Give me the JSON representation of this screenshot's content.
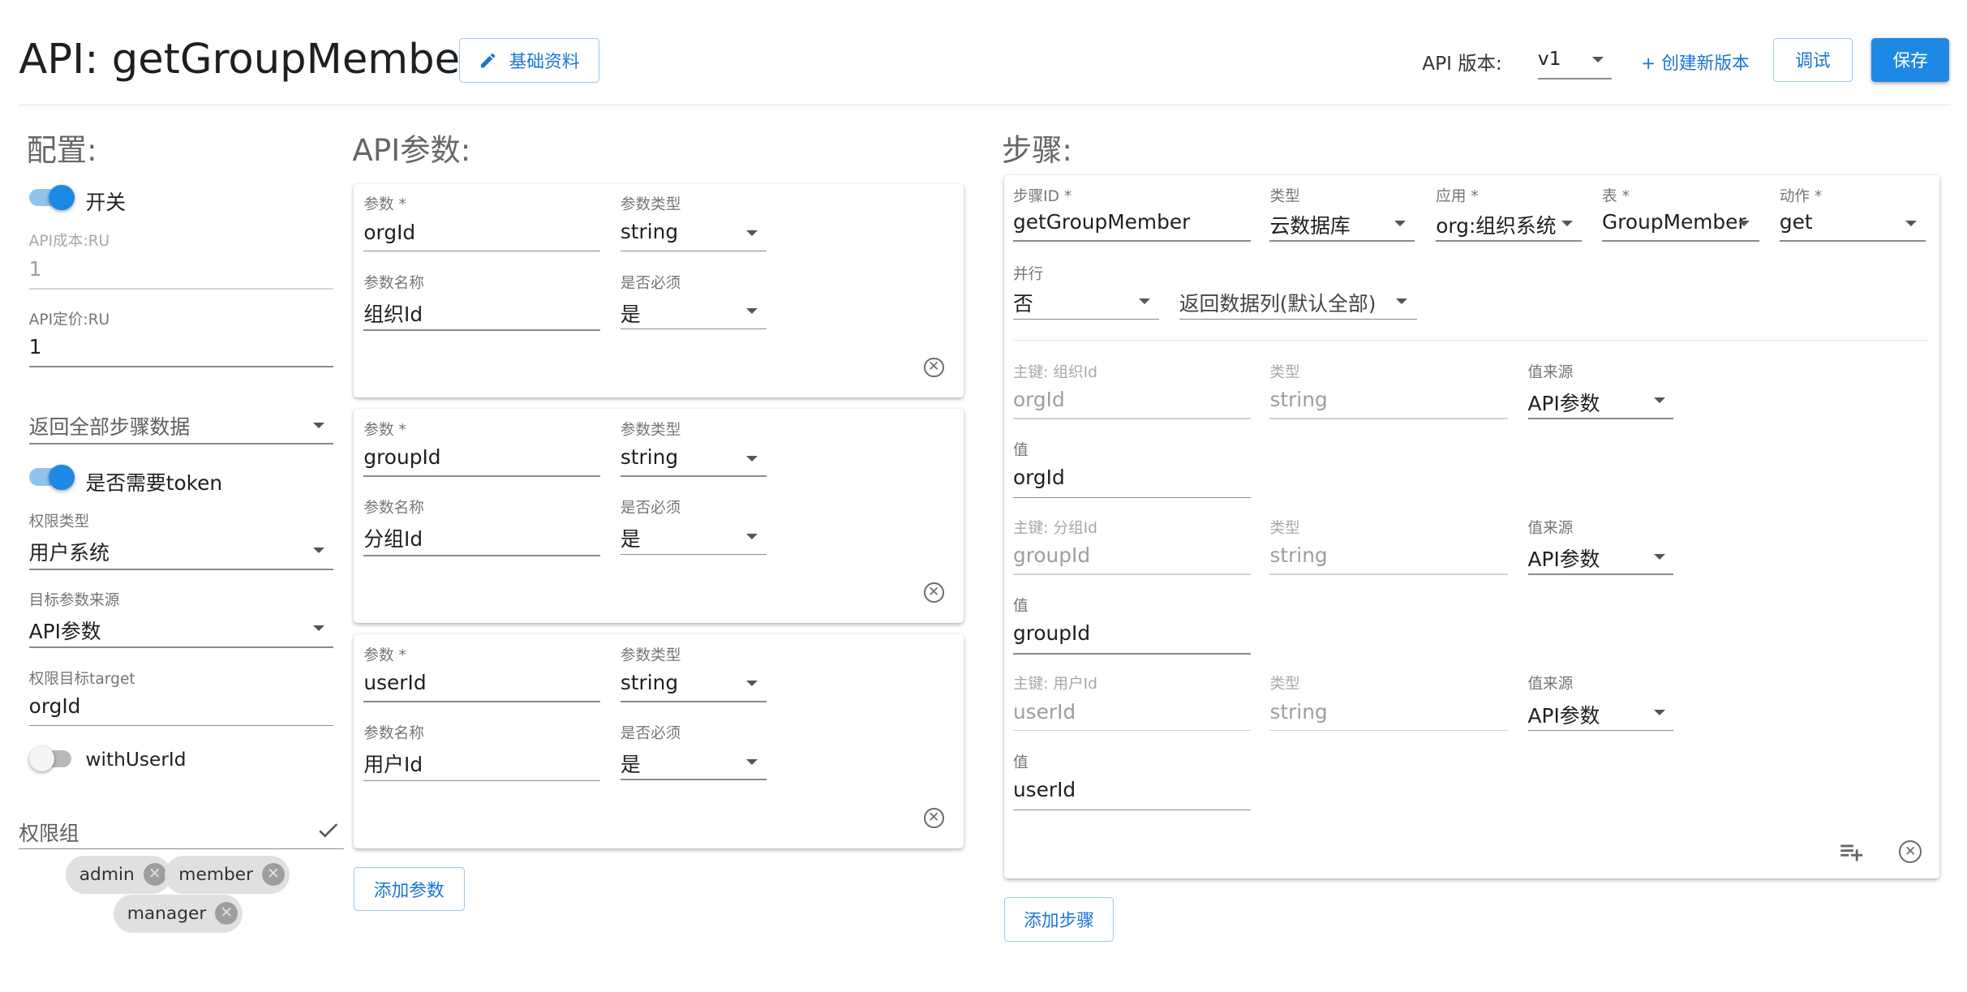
{
  "header": {
    "title": "API: getGroupMember",
    "basic_info_btn": "基础资料",
    "version_label": "API 版本:",
    "version_value": "v1",
    "create_version": "+ 创建新版本",
    "debug": "调试",
    "save": "保存"
  },
  "config": {
    "heading": "配置:",
    "switch_open_label": "开关",
    "api_cost_label": "API成本:RU",
    "api_cost_value": "1",
    "api_price_label": "API定价:RU",
    "api_price_value": "1",
    "return_steps_select": "返回全部步骤数据",
    "token_label": "是否需要token",
    "perm_type_label": "权限类型",
    "perm_type_value": "用户系统",
    "target_source_label": "目标参数来源",
    "target_source_value": "API参数",
    "perm_target_label": "权限目标target",
    "perm_target_value": "orgId",
    "with_user_id_label": "withUserId",
    "perm_group_label": "权限组",
    "perm_group_chips": [
      "admin",
      "member",
      "manager"
    ]
  },
  "params": {
    "heading": "API参数:",
    "labels": {
      "param": "参数",
      "type": "参数类型",
      "name": "参数名称",
      "required": "是否必须"
    },
    "items": [
      {
        "param": "orgId",
        "type": "string",
        "name": "组织Id",
        "required": "是"
      },
      {
        "param": "groupId",
        "type": "string",
        "name": "分组Id",
        "required": "是"
      },
      {
        "param": "userId",
        "type": "string",
        "name": "用户Id",
        "required": "是"
      }
    ],
    "add_button": "添加参数"
  },
  "steps": {
    "heading": "步骤:",
    "labels": {
      "step_id": "步骤ID",
      "type": "类型",
      "app": "应用",
      "table": "表",
      "action": "动作",
      "parallel": "并行",
      "key_type": "类型",
      "value_source": "值来源",
      "value": "值"
    },
    "step_id": "getGroupMember",
    "type": "云数据库",
    "app": "org:组织系统",
    "table": "GroupMember",
    "action": "get",
    "parallel": "否",
    "return_columns": "返回数据列(默认全部)",
    "keys": [
      {
        "key_label": "主键: 组织Id",
        "key": "orgId",
        "type": "string",
        "source": "API参数",
        "value": "orgId"
      },
      {
        "key_label": "主键: 分组Id",
        "key": "groupId",
        "type": "string",
        "source": "API参数",
        "value": "groupId"
      },
      {
        "key_label": "主键: 用户Id",
        "key": "userId",
        "type": "string",
        "source": "API参数",
        "value": "userId"
      }
    ],
    "add_button": "添加步骤"
  }
}
